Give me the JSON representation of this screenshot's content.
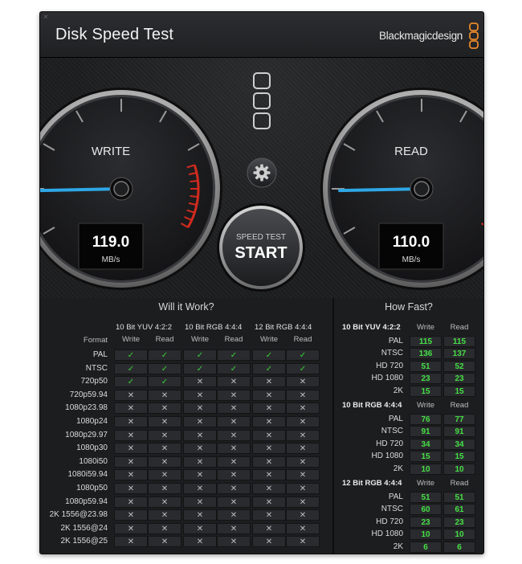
{
  "window": {
    "title": "Disk Speed Test",
    "brand": "Blackmagicdesign",
    "close_glyph": "×"
  },
  "gauges": {
    "write": {
      "label": "WRITE",
      "value": "119.0",
      "unit": "MB/s",
      "level": 0.56
    },
    "read": {
      "label": "READ",
      "value": "110.0",
      "unit": "MB/s",
      "level": 0.52
    }
  },
  "start_button": {
    "top": "SPEED TEST",
    "label": "START"
  },
  "icons": {
    "settings": "gear-icon",
    "drive_select": "drive-slots-icon",
    "close": "close-icon",
    "logo": "blackmagic-logo"
  },
  "colors": {
    "needle": "#2ea7e6",
    "ok": "#3ad13a",
    "value_green": "#45e045",
    "redzone": "#d22b1e"
  },
  "will_it_work": {
    "title": "Will it Work?",
    "format_header": "Format",
    "groups": [
      "10 Bit YUV 4:2:2",
      "10 Bit RGB 4:4:4",
      "12 Bit RGB 4:4:4"
    ],
    "sub_headers": [
      "Write",
      "Read",
      "Write",
      "Read",
      "Write",
      "Read"
    ],
    "rows": [
      {
        "format": "PAL",
        "cells": [
          "✓",
          "✓",
          "✓",
          "✓",
          "✓",
          "✓"
        ]
      },
      {
        "format": "NTSC",
        "cells": [
          "✓",
          "✓",
          "✓",
          "✓",
          "✓",
          "✓"
        ]
      },
      {
        "format": "720p50",
        "cells": [
          "✓",
          "✓",
          "✕",
          "✕",
          "✕",
          "✕"
        ]
      },
      {
        "format": "720p59.94",
        "cells": [
          "✕",
          "✕",
          "✕",
          "✕",
          "✕",
          "✕"
        ]
      },
      {
        "format": "1080p23.98",
        "cells": [
          "✕",
          "✕",
          "✕",
          "✕",
          "✕",
          "✕"
        ]
      },
      {
        "format": "1080p24",
        "cells": [
          "✕",
          "✕",
          "✕",
          "✕",
          "✕",
          "✕"
        ]
      },
      {
        "format": "1080p29.97",
        "cells": [
          "✕",
          "✕",
          "✕",
          "✕",
          "✕",
          "✕"
        ]
      },
      {
        "format": "1080p30",
        "cells": [
          "✕",
          "✕",
          "✕",
          "✕",
          "✕",
          "✕"
        ]
      },
      {
        "format": "1080i50",
        "cells": [
          "✕",
          "✕",
          "✕",
          "✕",
          "✕",
          "✕"
        ]
      },
      {
        "format": "1080i59.94",
        "cells": [
          "✕",
          "✕",
          "✕",
          "✕",
          "✕",
          "✕"
        ]
      },
      {
        "format": "1080p50",
        "cells": [
          "✕",
          "✕",
          "✕",
          "✕",
          "✕",
          "✕"
        ]
      },
      {
        "format": "1080p59.94",
        "cells": [
          "✕",
          "✕",
          "✕",
          "✕",
          "✕",
          "✕"
        ]
      },
      {
        "format": "2K 1556@23.98",
        "cells": [
          "✕",
          "✕",
          "✕",
          "✕",
          "✕",
          "✕"
        ]
      },
      {
        "format": "2K 1556@24",
        "cells": [
          "✕",
          "✕",
          "✕",
          "✕",
          "✕",
          "✕"
        ]
      },
      {
        "format": "2K 1556@25",
        "cells": [
          "✕",
          "✕",
          "✕",
          "✕",
          "✕",
          "✕"
        ]
      }
    ]
  },
  "how_fast": {
    "title": "How Fast?",
    "sections": [
      {
        "name": "10 Bit YUV 4:2:2",
        "write_label": "Write",
        "read_label": "Read",
        "rows": [
          {
            "format": "PAL",
            "write": "115",
            "read": "115"
          },
          {
            "format": "NTSC",
            "write": "136",
            "read": "137"
          },
          {
            "format": "HD 720",
            "write": "51",
            "read": "52"
          },
          {
            "format": "HD 1080",
            "write": "23",
            "read": "23"
          },
          {
            "format": "2K",
            "write": "15",
            "read": "15"
          }
        ]
      },
      {
        "name": "10 Bit RGB 4:4:4",
        "write_label": "Write",
        "read_label": "Read",
        "rows": [
          {
            "format": "PAL",
            "write": "76",
            "read": "77"
          },
          {
            "format": "NTSC",
            "write": "91",
            "read": "91"
          },
          {
            "format": "HD 720",
            "write": "34",
            "read": "34"
          },
          {
            "format": "HD 1080",
            "write": "15",
            "read": "15"
          },
          {
            "format": "2K",
            "write": "10",
            "read": "10"
          }
        ]
      },
      {
        "name": "12 Bit RGB 4:4:4",
        "write_label": "Write",
        "read_label": "Read",
        "rows": [
          {
            "format": "PAL",
            "write": "51",
            "read": "51"
          },
          {
            "format": "NTSC",
            "write": "60",
            "read": "61"
          },
          {
            "format": "HD 720",
            "write": "23",
            "read": "23"
          },
          {
            "format": "HD 1080",
            "write": "10",
            "read": "10"
          },
          {
            "format": "2K",
            "write": "6",
            "read": "6"
          }
        ]
      }
    ]
  }
}
